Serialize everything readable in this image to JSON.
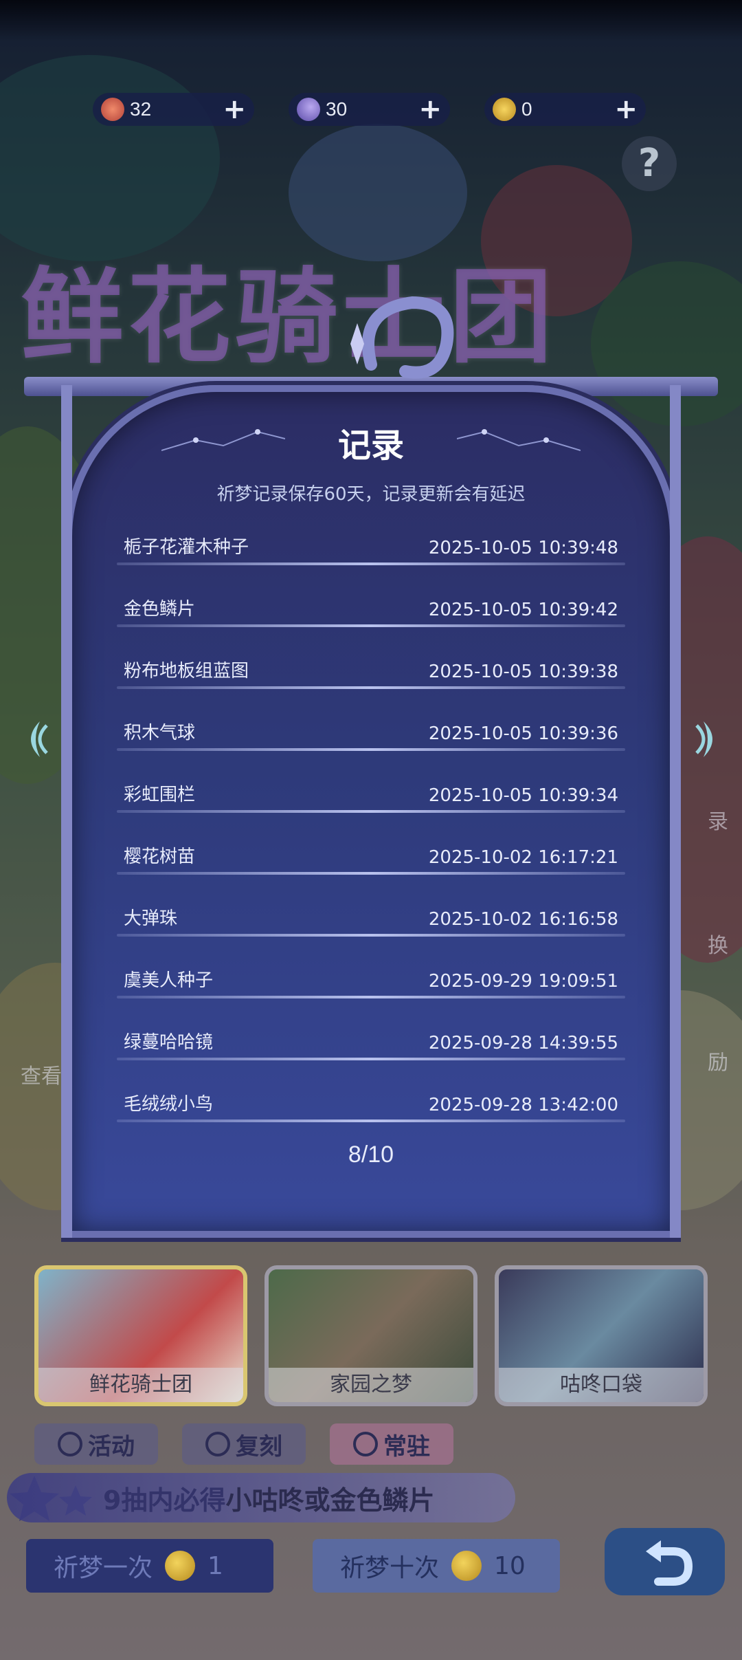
{
  "currencies": [
    {
      "id": "flower",
      "value": "32",
      "color": "#d86a5a"
    },
    {
      "id": "moon",
      "value": "30",
      "color": "#9a88d9"
    },
    {
      "id": "gold",
      "value": "0",
      "color": "#e0b43a"
    }
  ],
  "plus_symbol": "+",
  "help_symbol": "?",
  "banner_title": "鲜花骑士团",
  "modal": {
    "title": "记录",
    "subtitle": "祈梦记录保存60天，记录更新会有延迟",
    "records": [
      {
        "name": "栀子花灌木种子",
        "time": "2025-10-05 10:39:48"
      },
      {
        "name": "金色鳞片",
        "time": "2025-10-05 10:39:42"
      },
      {
        "name": "粉布地板组蓝图",
        "time": "2025-10-05 10:39:38"
      },
      {
        "name": "积木气球",
        "time": "2025-10-05 10:39:36"
      },
      {
        "name": "彩虹围栏",
        "time": "2025-10-05 10:39:34"
      },
      {
        "name": "樱花树苗",
        "time": "2025-10-02 16:17:21"
      },
      {
        "name": "大弹珠",
        "time": "2025-10-02 16:16:58"
      },
      {
        "name": "虞美人种子",
        "time": "2025-09-29 19:09:51"
      },
      {
        "name": "绿蔓哈哈镜",
        "time": "2025-09-28 14:39:55"
      },
      {
        "name": "毛绒绒小鸟",
        "time": "2025-09-28 13:42:00"
      }
    ],
    "page": "8/10"
  },
  "side_labels": {
    "left_view": "查看角色",
    "right_record": "录",
    "right_exchange": "换",
    "right_reward": "励"
  },
  "pools": [
    {
      "label": "鲜花骑士团",
      "active": true
    },
    {
      "label": "家园之梦",
      "active": false
    },
    {
      "label": "咕咚口袋",
      "active": false
    }
  ],
  "tabs": [
    {
      "label": "活动"
    },
    {
      "label": "复刻"
    },
    {
      "label": "常驻"
    }
  ],
  "promo": {
    "prefix": "9抽内必得",
    "highlight": "小咕咚或金色鳞片"
  },
  "pray_one": {
    "label": "祈梦一次",
    "cost": "1"
  },
  "pray_ten": {
    "label": "祈梦十次",
    "cost": "10"
  }
}
